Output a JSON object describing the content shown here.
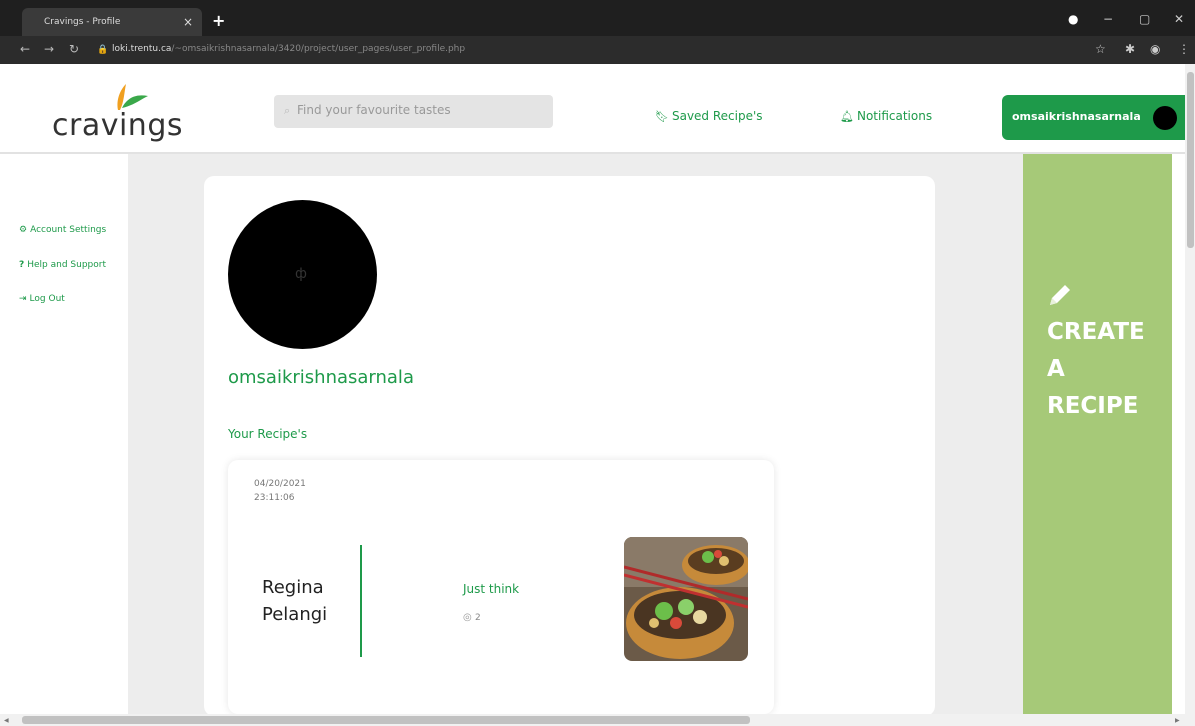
{
  "browser": {
    "tab_title": "Cravings - Profile",
    "tab_close": "×",
    "new_tab": "+",
    "url_host": "loki.trentu.ca",
    "url_path": "/~omsaikrishnasarnala/3420/project/user_pages/user_profile.php"
  },
  "header": {
    "logo_text": "cravings",
    "search_placeholder": "Find your favourite tastes",
    "saved_recipes_label": "Saved Recipe's",
    "notifications_label": "Notifications",
    "user_label": "omsaikrishnasarnala"
  },
  "sidebar": {
    "items": [
      {
        "icon": "gear-icon",
        "label": "Account Settings"
      },
      {
        "icon": "question-icon",
        "label": "Help and Support"
      },
      {
        "icon": "logout-icon",
        "label": "Log Out"
      }
    ]
  },
  "profile": {
    "username": "omsaikrishnasarnala",
    "section_title": "Your Recipe's",
    "avatar_glyph": "ф"
  },
  "recipes": [
    {
      "date": "04/20/2021",
      "time": "23:11:06",
      "name": "Regina Pelangi",
      "description": "Just think",
      "views": "2"
    }
  ],
  "create_panel": {
    "label": "CREATE A RECIPE"
  },
  "colors": {
    "accent": "#1e9a4a",
    "create_panel": "#a6c978",
    "page_gray": "#ededed"
  }
}
